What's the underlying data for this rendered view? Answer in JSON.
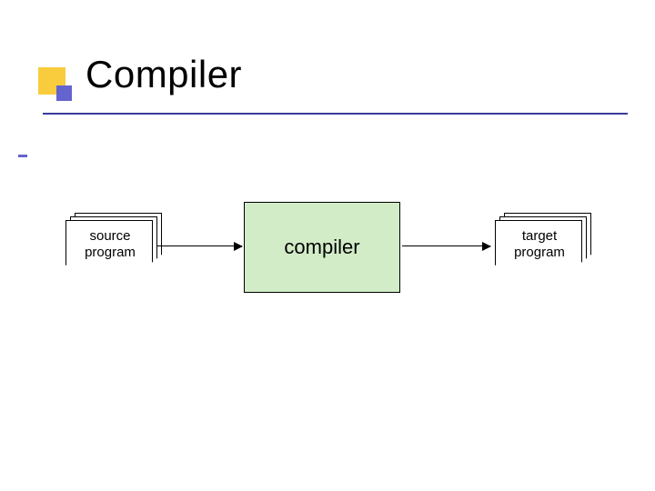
{
  "title": "Compiler",
  "diagram": {
    "source_label_line1": "source",
    "source_label_line2": "program",
    "compiler_label": "compiler",
    "target_label_line1": "target",
    "target_label_line2": "program"
  },
  "colors": {
    "accent_yellow": "#f8cc3c",
    "accent_blue": "#6464ce",
    "rule_blue": "#3a3a9c",
    "box_fill": "#d2ecc8"
  }
}
